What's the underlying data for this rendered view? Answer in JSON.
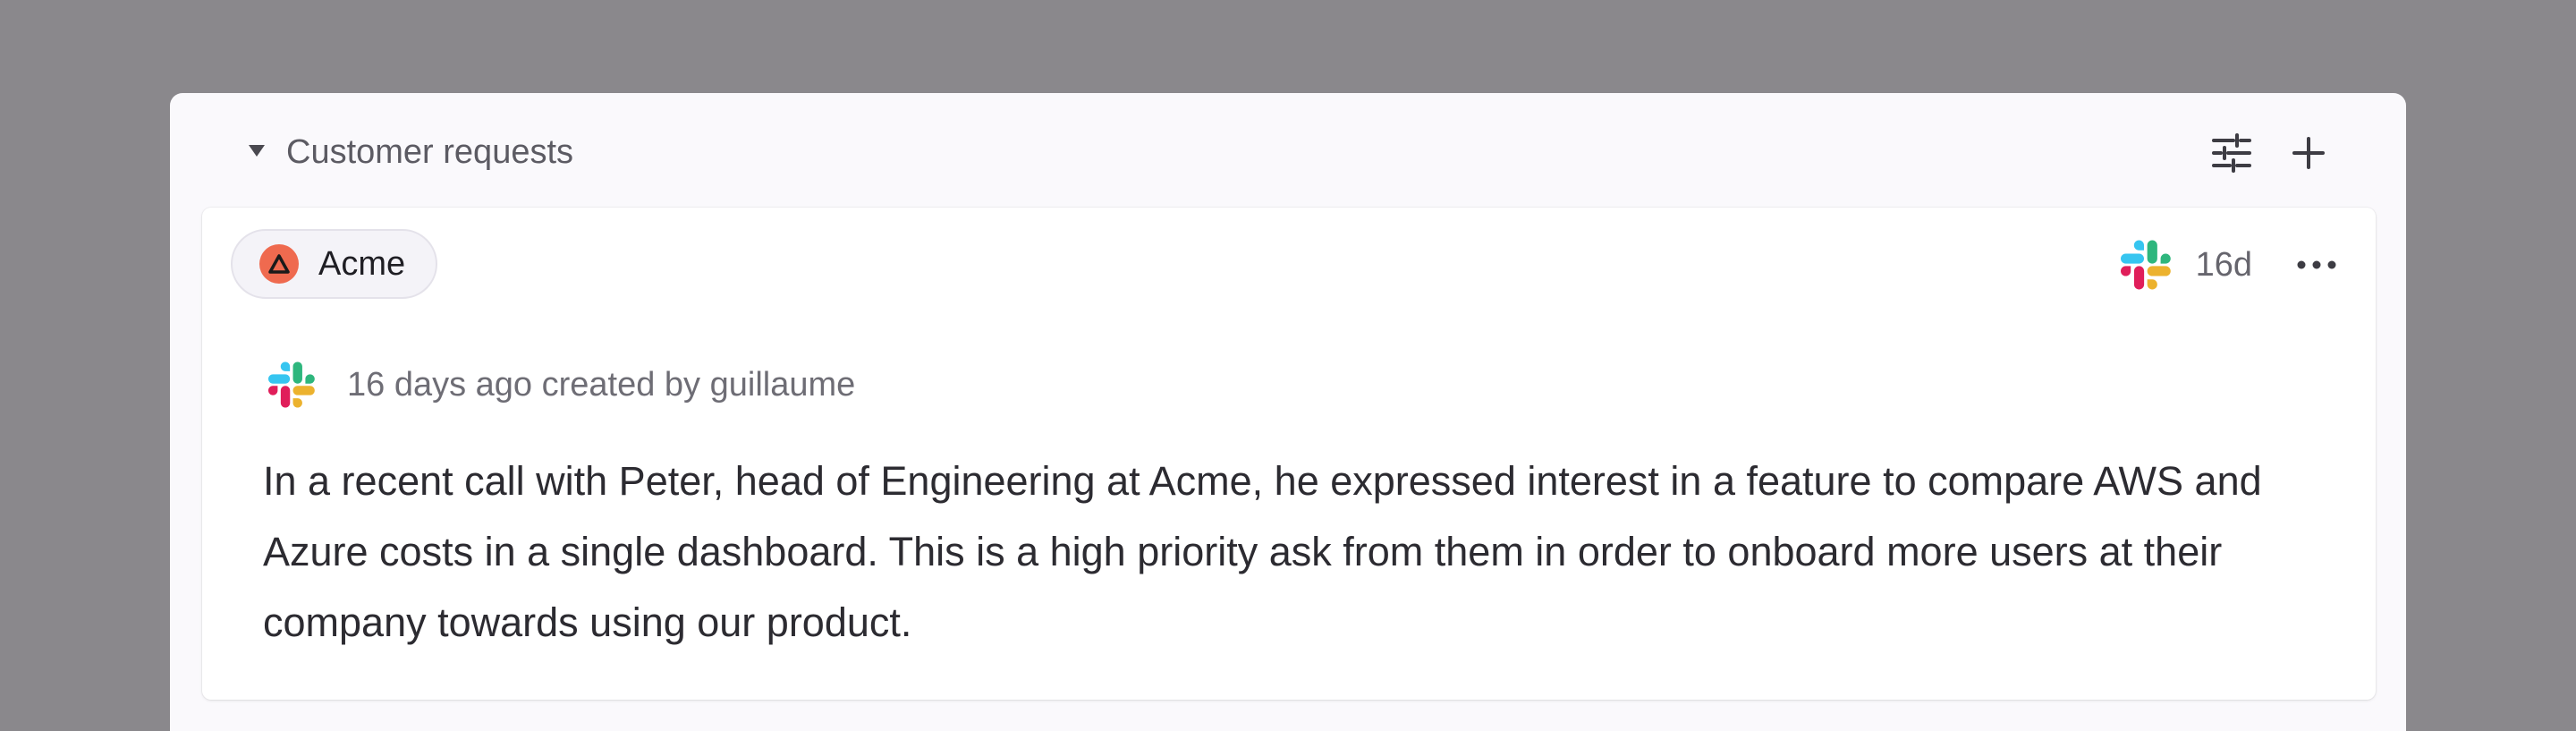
{
  "section": {
    "title": "Customer requests",
    "filter_icon": "sliders-icon",
    "add_icon": "plus-icon",
    "collapse_icon": "triangle-down-icon"
  },
  "card": {
    "company": {
      "name": "Acme",
      "logo_icon": "triangle-logo-icon",
      "logo_color": "#ef6a4f"
    },
    "source_icon": "slack-icon",
    "age": "16d",
    "more_icon": "ellipsis-icon",
    "meta_text": "16 days ago created by guillaume",
    "body": "In a recent call with Peter, head of Engineering at Acme, he expressed interest in a feature to compare AWS and Azure costs in a single dashboard. This is a high priority ask from them in order to onboard more users at their company towards using our product."
  },
  "colors": {
    "backdrop": "#8a888c",
    "panel": "#faf9fc",
    "slack_blue": "#36c5f0",
    "slack_green": "#2eb67d",
    "slack_yellow": "#ecb22e",
    "slack_red": "#e01e5a"
  }
}
